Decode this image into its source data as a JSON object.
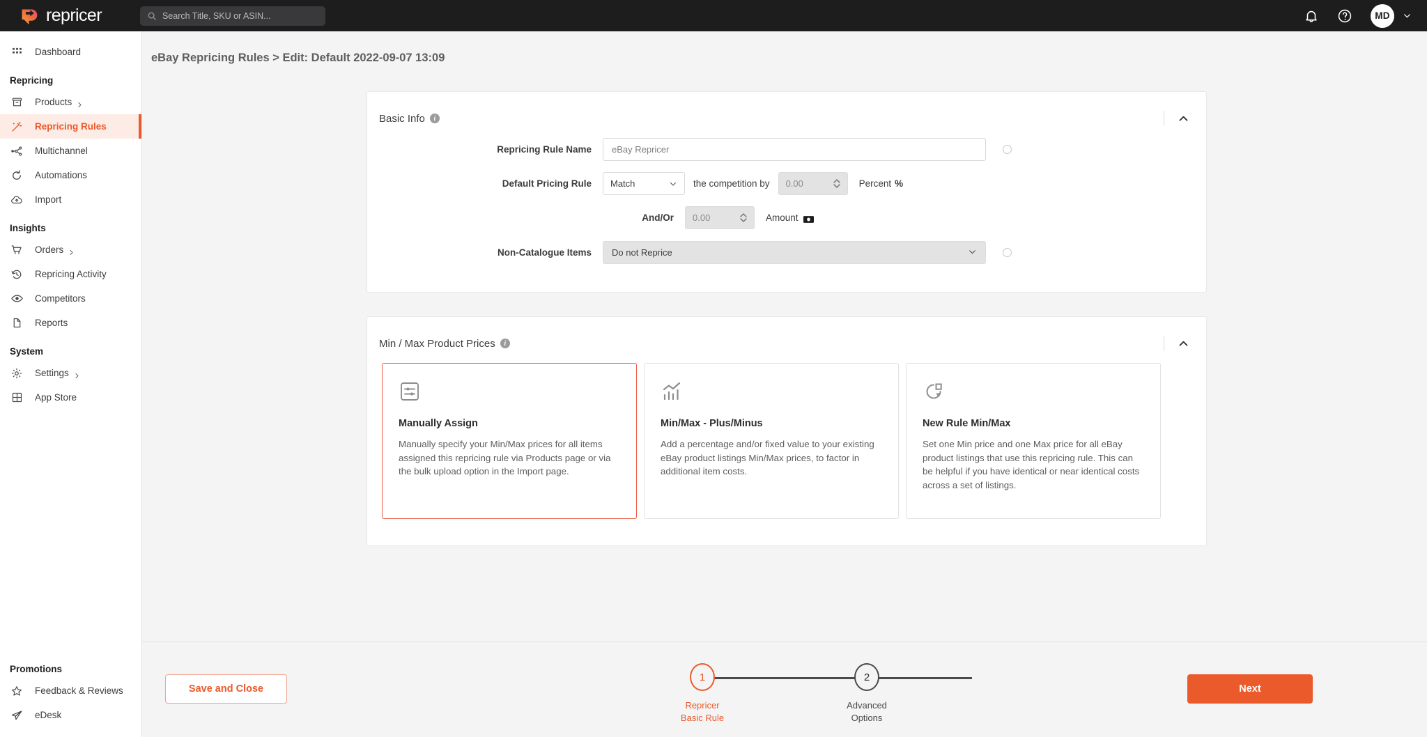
{
  "topbar": {
    "logo_text": "repricer",
    "search_placeholder": "Search Title, SKU or ASIN...",
    "search_value": "",
    "avatar_initials": "MD"
  },
  "sidebar": {
    "items": [
      {
        "label": "Dashboard",
        "icon": "grid-icon",
        "caret": false,
        "active": false
      }
    ],
    "groups": [
      {
        "heading": "Repricing",
        "items": [
          {
            "label": "Products",
            "icon": "box-icon",
            "caret": true,
            "active": false
          },
          {
            "label": "Repricing Rules",
            "icon": "magic-wand-icon",
            "caret": false,
            "active": true
          },
          {
            "label": "Multichannel",
            "icon": "network-icon",
            "caret": false,
            "active": false
          },
          {
            "label": "Automations",
            "icon": "refresh-icon",
            "caret": false,
            "active": false
          },
          {
            "label": "Import",
            "icon": "cloud-upload-icon",
            "caret": false,
            "active": false
          }
        ]
      },
      {
        "heading": "Insights",
        "items": [
          {
            "label": "Orders",
            "icon": "cart-icon",
            "caret": true,
            "active": false
          },
          {
            "label": "Repricing Activity",
            "icon": "history-icon",
            "caret": false,
            "active": false
          },
          {
            "label": "Competitors",
            "icon": "eye-icon",
            "caret": false,
            "active": false
          },
          {
            "label": "Reports",
            "icon": "document-icon",
            "caret": false,
            "active": false
          }
        ]
      },
      {
        "heading": "System",
        "items": [
          {
            "label": "Settings",
            "icon": "gear-icon",
            "caret": true,
            "active": false
          },
          {
            "label": "App Store",
            "icon": "apps-grid-icon",
            "caret": false,
            "active": false
          }
        ]
      }
    ],
    "bottom_group": {
      "heading": "Promotions",
      "items": [
        {
          "label": "Feedback & Reviews",
          "icon": "star-icon",
          "caret": false,
          "active": false
        },
        {
          "label": "eDesk",
          "icon": "paper-plane-icon",
          "caret": false,
          "active": false
        }
      ]
    }
  },
  "breadcrumb": "eBay Repricing Rules > Edit: Default 2022-09-07 13:09",
  "basic_info": {
    "title": "Basic Info",
    "fields": {
      "rule_name_label": "Repricing Rule Name",
      "rule_name_value": "eBay Repricer",
      "pricing_rule_label": "Default Pricing Rule",
      "pricing_rule_value": "Match",
      "competition_text": "the competition by",
      "percent_value": "0.00",
      "percent_suffix": "Percent",
      "percent_symbol": "%",
      "andor_label": "And/Or",
      "amount_value": "0.00",
      "amount_suffix": "Amount",
      "non_catalogue_label": "Non-Catalogue Items",
      "non_catalogue_value": "Do not Reprice"
    }
  },
  "min_max": {
    "title": "Min / Max Product Prices",
    "cards": [
      {
        "icon": "sliders-icon",
        "title": "Manually Assign",
        "desc": "Manually specify your Min/Max prices for all items assigned this repricing rule via Products page or via the bulk upload option in the Import page.",
        "selected": true
      },
      {
        "icon": "bar-chart-icon",
        "title": "Min/Max - Plus/Minus",
        "desc": "Add a percentage and/or fixed value to your existing eBay product listings Min/Max prices, to factor in additional item costs.",
        "selected": false
      },
      {
        "icon": "pie-chart-icon",
        "title": "New Rule Min/Max",
        "desc": "Set one Min price and one Max price for all eBay product listings that use this repricing rule. This can be helpful if you have identical or near identical costs across a set of listings.",
        "selected": false
      }
    ]
  },
  "footer": {
    "save_label": "Save and Close",
    "next_label": "Next",
    "steps": [
      {
        "number": "1",
        "line1": "Repricer",
        "line2": "Basic Rule",
        "active": true
      },
      {
        "number": "2",
        "line1": "Advanced",
        "line2": "Options",
        "active": false
      }
    ]
  },
  "colors": {
    "accent": "#ea5a2a",
    "accent_soft": "#fdece6",
    "topbar_bg": "#1d1d1d",
    "page_bg": "#f4f4f4"
  }
}
